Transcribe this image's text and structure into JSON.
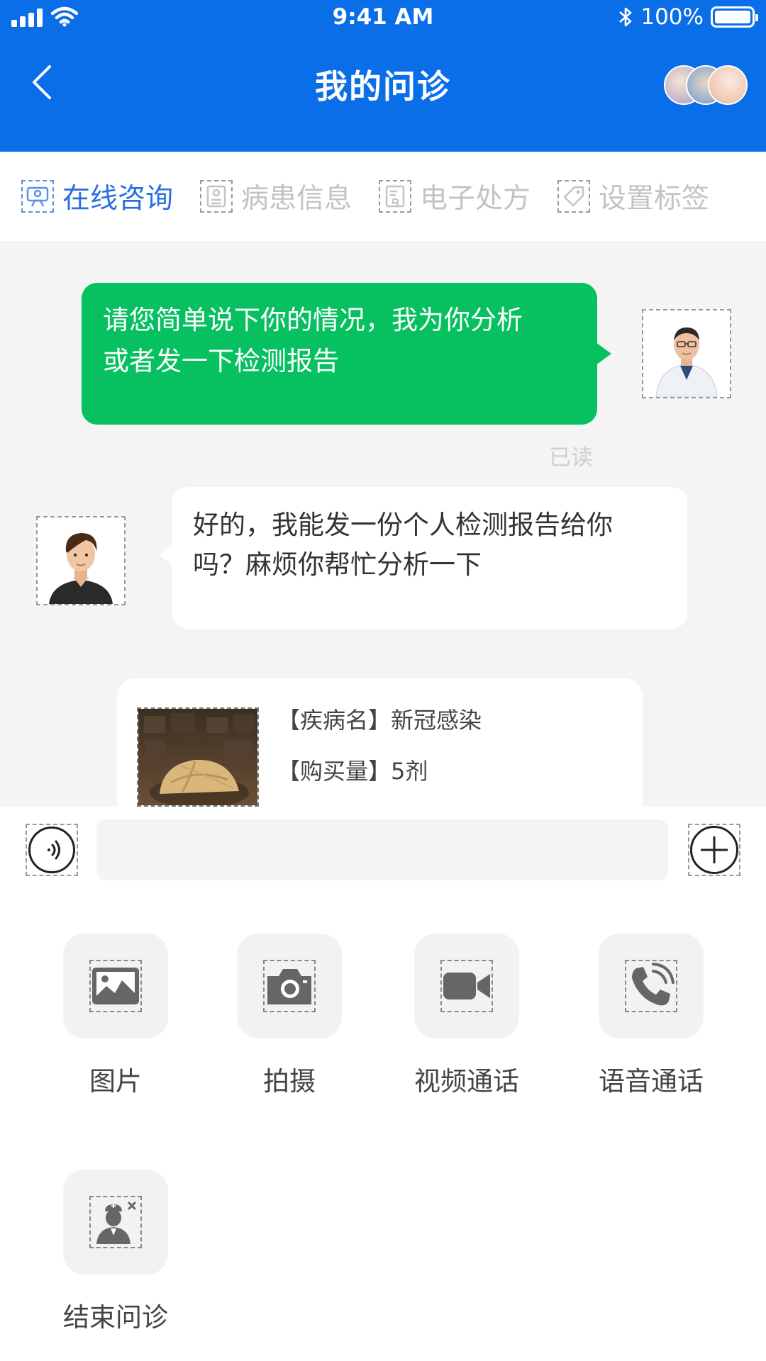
{
  "status_bar": {
    "time": "9:41 AM",
    "battery": "100%"
  },
  "header": {
    "title": "我的问诊"
  },
  "tabs": [
    {
      "label": "在线咨询",
      "icon": "consult-icon",
      "active": true
    },
    {
      "label": "病患信息",
      "icon": "patient-info-icon",
      "active": false
    },
    {
      "label": "电子处方",
      "icon": "prescription-icon",
      "active": false
    },
    {
      "label": "设置标签",
      "icon": "tag-icon",
      "active": false
    }
  ],
  "chat": {
    "doctor_message": {
      "line1": "请您简单说下你的情况，我为你分析",
      "line2": "或者发一下检测报告",
      "status": "已读"
    },
    "patient_message": {
      "line1": "好的，我能发一份个人检测报告给你",
      "line2": "吗？麻烦你帮忙分析一下"
    },
    "prescription_card": {
      "disease_label": "【疾病名】",
      "disease": "新冠感染",
      "quantity_label": "【购买量】",
      "quantity": "5剂"
    }
  },
  "input": {
    "value": "",
    "placeholder": ""
  },
  "functions": [
    {
      "label": "图片",
      "icon": "image-icon"
    },
    {
      "label": "拍摄",
      "icon": "camera-icon"
    },
    {
      "label": "视频通话",
      "icon": "video-call-icon"
    },
    {
      "label": "语音通话",
      "icon": "voice-call-icon"
    },
    {
      "label": "结束问诊",
      "icon": "end-consult-icon"
    }
  ],
  "colors": {
    "header": "#0a6ee8",
    "bubble": "#07c160",
    "active_tab": "#2a6fe0"
  }
}
